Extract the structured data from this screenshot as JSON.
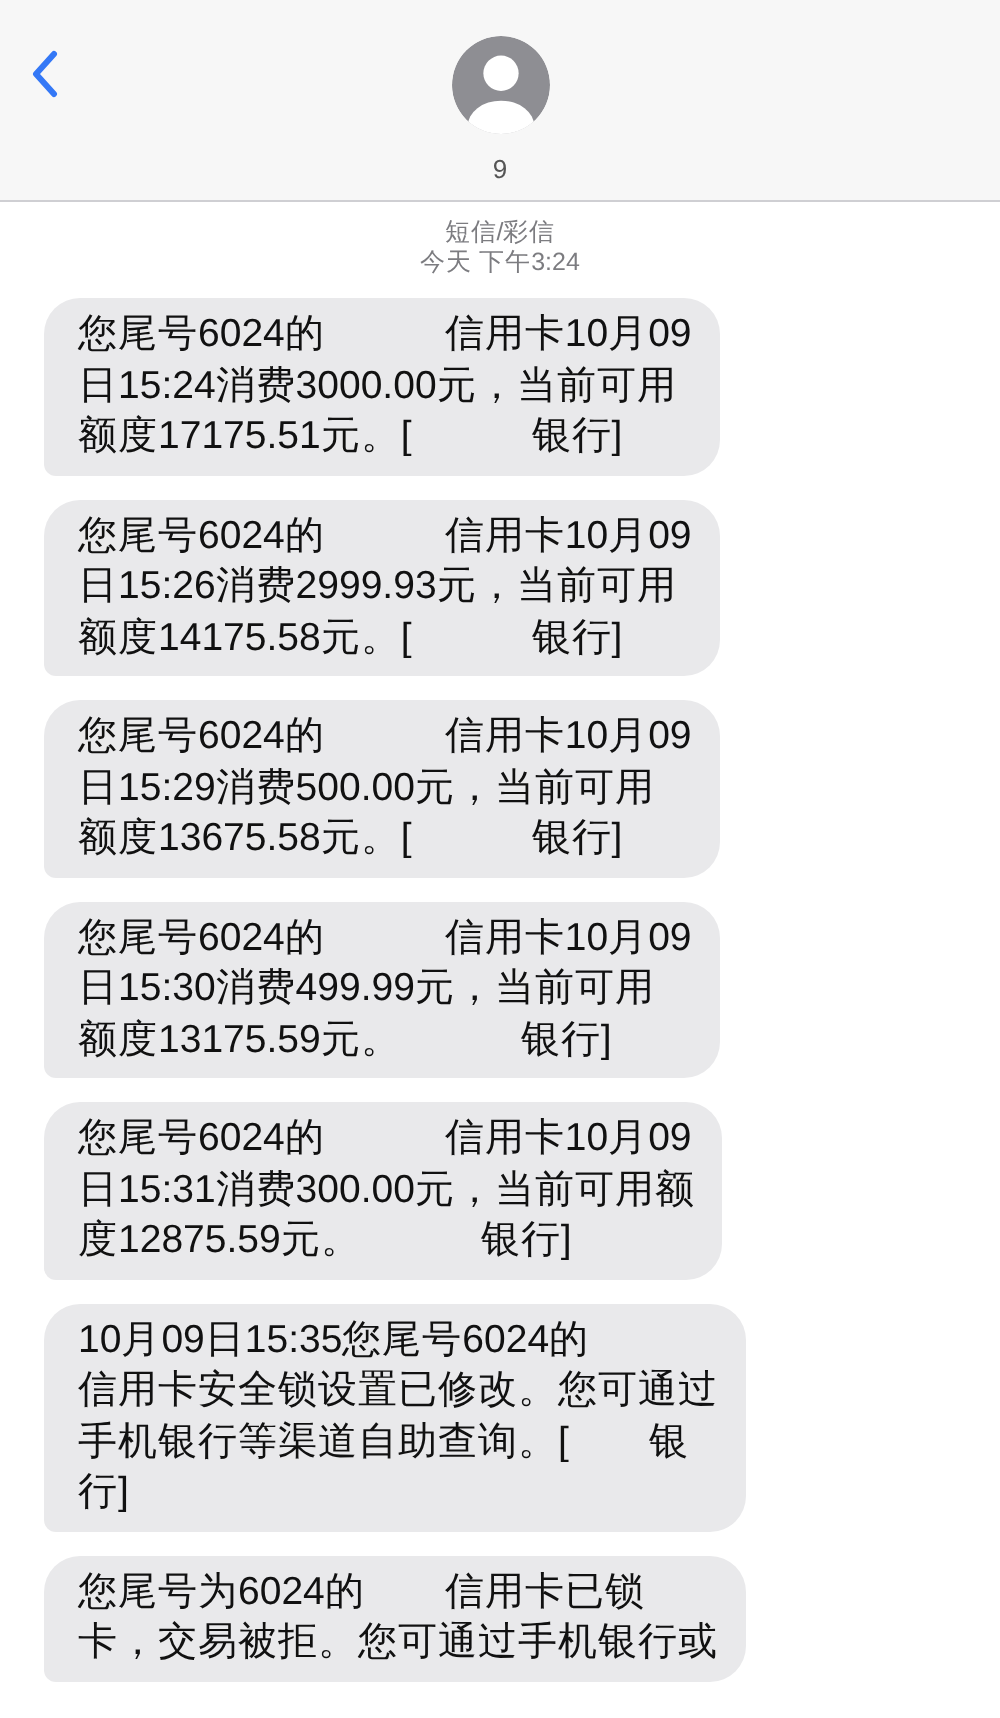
{
  "header": {
    "contact_name": "9"
  },
  "thread_info": {
    "service": "短信/彩信",
    "timestamp": "今天 下午3:24"
  },
  "messages": [
    {
      "lines": [
        "您尾号6024的　　　信用卡10月09",
        "日15:24消费3000.00元，当前可用",
        "额度17175.51元。[　　　银行]"
      ]
    },
    {
      "lines": [
        "您尾号6024的　　　信用卡10月09",
        "日15:26消费2999.93元，当前可用",
        "额度14175.58元。[　　　银行]"
      ]
    },
    {
      "lines": [
        "您尾号6024的　　　信用卡10月09",
        "日15:29消费500.00元，当前可用",
        "额度13675.58元。[　　　银行]"
      ]
    },
    {
      "lines": [
        "您尾号6024的　　　信用卡10月09",
        "日15:30消费499.99元，当前可用",
        "额度13175.59元。　　　银行]"
      ]
    },
    {
      "lines": [
        "您尾号6024的　　　信用卡10月09",
        "日15:31消费300.00元，当前可用额",
        "度12875.59元。　　　银行]"
      ]
    },
    {
      "lines": [
        "10月09日15:35您尾号6024的",
        "信用卡安全锁设置已修改。您可通过",
        "手机银行等渠道自助查询。[　　银",
        "行]"
      ]
    },
    {
      "lines": [
        "您尾号为6024的　　信用卡已锁",
        "卡，交易被拒。您可通过手机银行或"
      ]
    }
  ]
}
